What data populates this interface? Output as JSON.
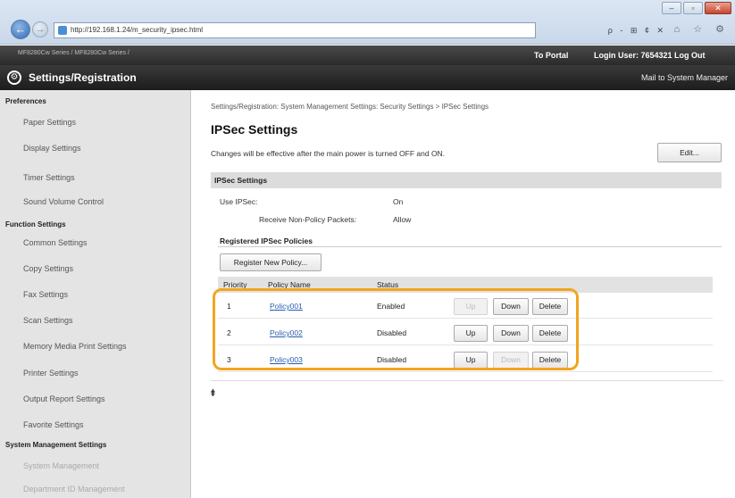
{
  "browser": {
    "url": "http://192.168.1.24/m_security_ipsec.html",
    "search_tools": "ρ - ⊞ ¢ ✕",
    "tab_icons": "⌂ ☆ ⚙",
    "window_controls": {
      "minimize": "–",
      "maximize": "▫",
      "close": "✕"
    }
  },
  "topbar": {
    "device_name": "MF8280Cw Series / MF8280Cw Series /",
    "to_portal": "To Portal",
    "login": "Login User:  7654321  Log Out"
  },
  "header": {
    "title": "Settings/Registration",
    "mail_link": "Mail to System Manager"
  },
  "sidebar": {
    "sections": [
      {
        "title": "Preferences",
        "items": [
          "Paper Settings",
          "Display Settings",
          "Timer Settings",
          "Sound Volume Control"
        ]
      },
      {
        "title": "Function Settings",
        "items": [
          "Common Settings",
          "Copy Settings",
          "Fax Settings",
          "Scan Settings",
          "Memory Media Print Settings",
          "Printer Settings",
          "Output Report Settings",
          "Favorite Settings"
        ]
      },
      {
        "title": "System Management Settings",
        "items": [
          "System Management",
          "Department ID Management"
        ]
      }
    ]
  },
  "main": {
    "breadcrumb": "Settings/Registration: System Management Settings: Security Settings > IPSec Settings",
    "title": "IPSec Settings",
    "notice": "Changes will be effective after the main power is turned OFF and ON.",
    "edit_label": "Edit...",
    "section_title": "IPSec Settings",
    "use_ipsec_label": "Use IPSec:",
    "use_ipsec_value": "On",
    "receive_label": "Receive Non-Policy Packets:",
    "receive_value": "Allow",
    "policies_title": "Registered IPSec Policies",
    "register_label": "Register New Policy...",
    "columns": {
      "priority": "Priority",
      "name": "Policy Name",
      "status": "Status"
    },
    "buttons": {
      "up": "Up",
      "down": "Down",
      "delete": "Delete"
    },
    "policies": [
      {
        "priority": "1",
        "name": "Policy001",
        "status": "Enabled"
      },
      {
        "priority": "2",
        "name": "Policy002",
        "status": "Disabled"
      },
      {
        "priority": "3",
        "name": "Policy003",
        "status": "Disabled"
      }
    ],
    "top_icon": "⯒"
  },
  "colors": {
    "highlight": "#f2a51f",
    "link": "#2a5db0",
    "dark_bar": "#2a2a2a"
  }
}
